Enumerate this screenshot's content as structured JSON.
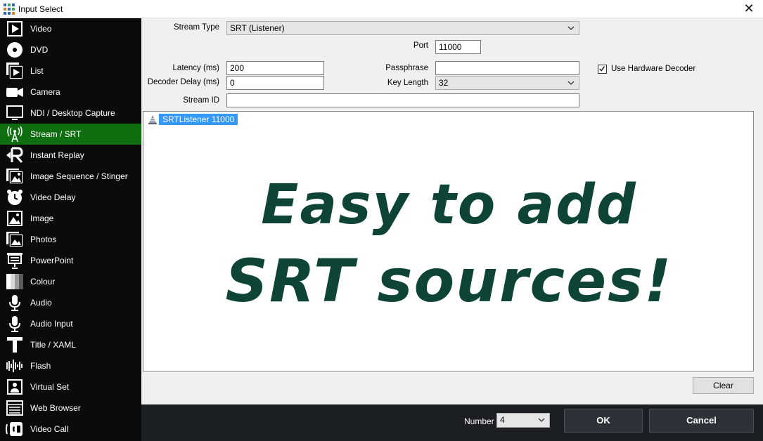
{
  "window": {
    "title": "Input Select",
    "close_glyph": "✕"
  },
  "sidebar": {
    "items": [
      {
        "label": "Video",
        "icon": "video-play-icon",
        "active": false
      },
      {
        "label": "DVD",
        "icon": "disc-icon",
        "active": false
      },
      {
        "label": "List",
        "icon": "list-play-icon",
        "active": false
      },
      {
        "label": "Camera",
        "icon": "camera-icon",
        "active": false
      },
      {
        "label": "NDI / Desktop Capture",
        "icon": "monitor-icon",
        "active": false
      },
      {
        "label": "Stream / SRT",
        "icon": "antenna-icon",
        "active": true
      },
      {
        "label": "Instant Replay",
        "icon": "replay-icon",
        "active": false
      },
      {
        "label": "Image Sequence / Stinger",
        "icon": "image-sequence-icon",
        "active": false
      },
      {
        "label": "Video Delay",
        "icon": "timer-icon",
        "active": false
      },
      {
        "label": "Image",
        "icon": "image-icon",
        "active": false
      },
      {
        "label": "Photos",
        "icon": "photos-icon",
        "active": false
      },
      {
        "label": "PowerPoint",
        "icon": "presentation-icon",
        "active": false
      },
      {
        "label": "Colour",
        "icon": "colour-bars-icon",
        "active": false
      },
      {
        "label": "Audio",
        "icon": "microphone-icon",
        "active": false
      },
      {
        "label": "Audio Input",
        "icon": "microphone-input-icon",
        "active": false
      },
      {
        "label": "Title / XAML",
        "icon": "title-t-icon",
        "active": false
      },
      {
        "label": "Flash",
        "icon": "waveform-icon",
        "active": false
      },
      {
        "label": "Virtual Set",
        "icon": "virtual-set-icon",
        "active": false
      },
      {
        "label": "Web Browser",
        "icon": "browser-icon",
        "active": false
      },
      {
        "label": "Video Call",
        "icon": "video-call-icon",
        "active": false
      }
    ],
    "active_color": "#0f6e10"
  },
  "form": {
    "stream_type_label": "Stream Type",
    "stream_type_value": "SRT (Listener)",
    "port_label": "Port",
    "port_value": "11000",
    "latency_label": "Latency (ms)",
    "latency_value": "200",
    "passphrase_label": "Passphrase",
    "passphrase_value": "",
    "use_hw_decoder_label": "Use Hardware Decoder",
    "use_hw_decoder_checked": true,
    "decoder_delay_label": "Decoder Delay (ms)",
    "decoder_delay_value": "0",
    "key_length_label": "Key Length",
    "key_length_value": "32",
    "stream_id_label": "Stream ID",
    "stream_id_value": ""
  },
  "list": {
    "entries": [
      {
        "label": "SRTListener  11000",
        "icon": "vlc-cone-icon",
        "selected": true
      }
    ],
    "promo_line1": "Easy to add",
    "promo_line2": "SRT sources!",
    "promo_color": "#0d4436"
  },
  "buttons": {
    "clear": "Clear",
    "ok": "OK",
    "cancel": "Cancel"
  },
  "footer": {
    "number_label": "Number",
    "number_value": "4"
  }
}
